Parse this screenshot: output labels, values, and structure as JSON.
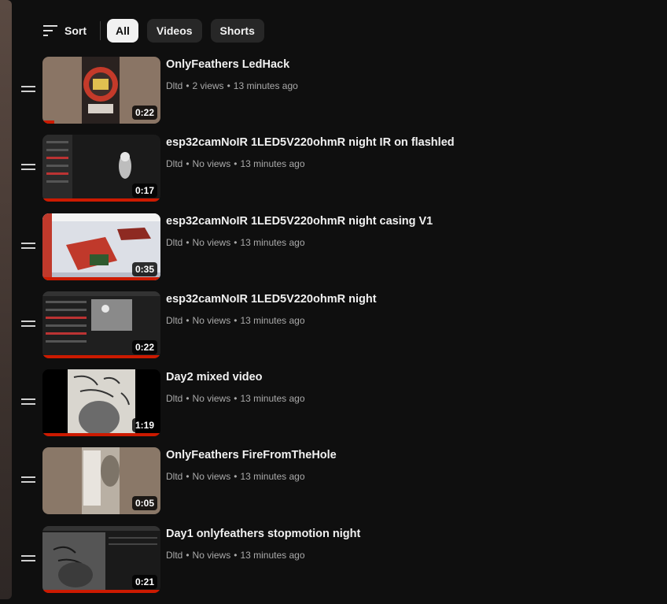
{
  "toolbar": {
    "sort_label": "Sort",
    "chips": [
      "All",
      "Videos",
      "Shorts"
    ]
  },
  "videos": [
    {
      "title": "OnlyFeathers LedHack",
      "channel": "Dltd",
      "views": "2 views",
      "age": "13 minutes ago",
      "duration": "0:22",
      "watched_fraction": 0.1
    },
    {
      "title": "esp32camNoIR 1LED5V220ohmR night IR on flashled",
      "channel": "Dltd",
      "views": "No views",
      "age": "13 minutes ago",
      "duration": "0:17",
      "watched_fraction": 1.0
    },
    {
      "title": "esp32camNoIR 1LED5V220ohmR night casing V1",
      "channel": "Dltd",
      "views": "No views",
      "age": "13 minutes ago",
      "duration": "0:35",
      "watched_fraction": 1.0
    },
    {
      "title": "esp32camNoIR 1LED5V220ohmR night",
      "channel": "Dltd",
      "views": "No views",
      "age": "13 minutes ago",
      "duration": "0:22",
      "watched_fraction": 1.0
    },
    {
      "title": "Day2 mixed video",
      "channel": "Dltd",
      "views": "No views",
      "age": "13 minutes ago",
      "duration": "1:19",
      "watched_fraction": 1.0
    },
    {
      "title": "OnlyFeathers FireFromTheHole",
      "channel": "Dltd",
      "views": "No views",
      "age": "13 minutes ago",
      "duration": "0:05",
      "watched_fraction": 0.0
    },
    {
      "title": "Day1 onlyfeathers stopmotion night",
      "channel": "Dltd",
      "views": "No views",
      "age": "13 minutes ago",
      "duration": "0:21",
      "watched_fraction": 1.0
    }
  ],
  "colors": {
    "background": "#0f0f0f",
    "progress": "#cc1a00",
    "chip_active": "#f1f1f1",
    "chip": "#272727"
  }
}
